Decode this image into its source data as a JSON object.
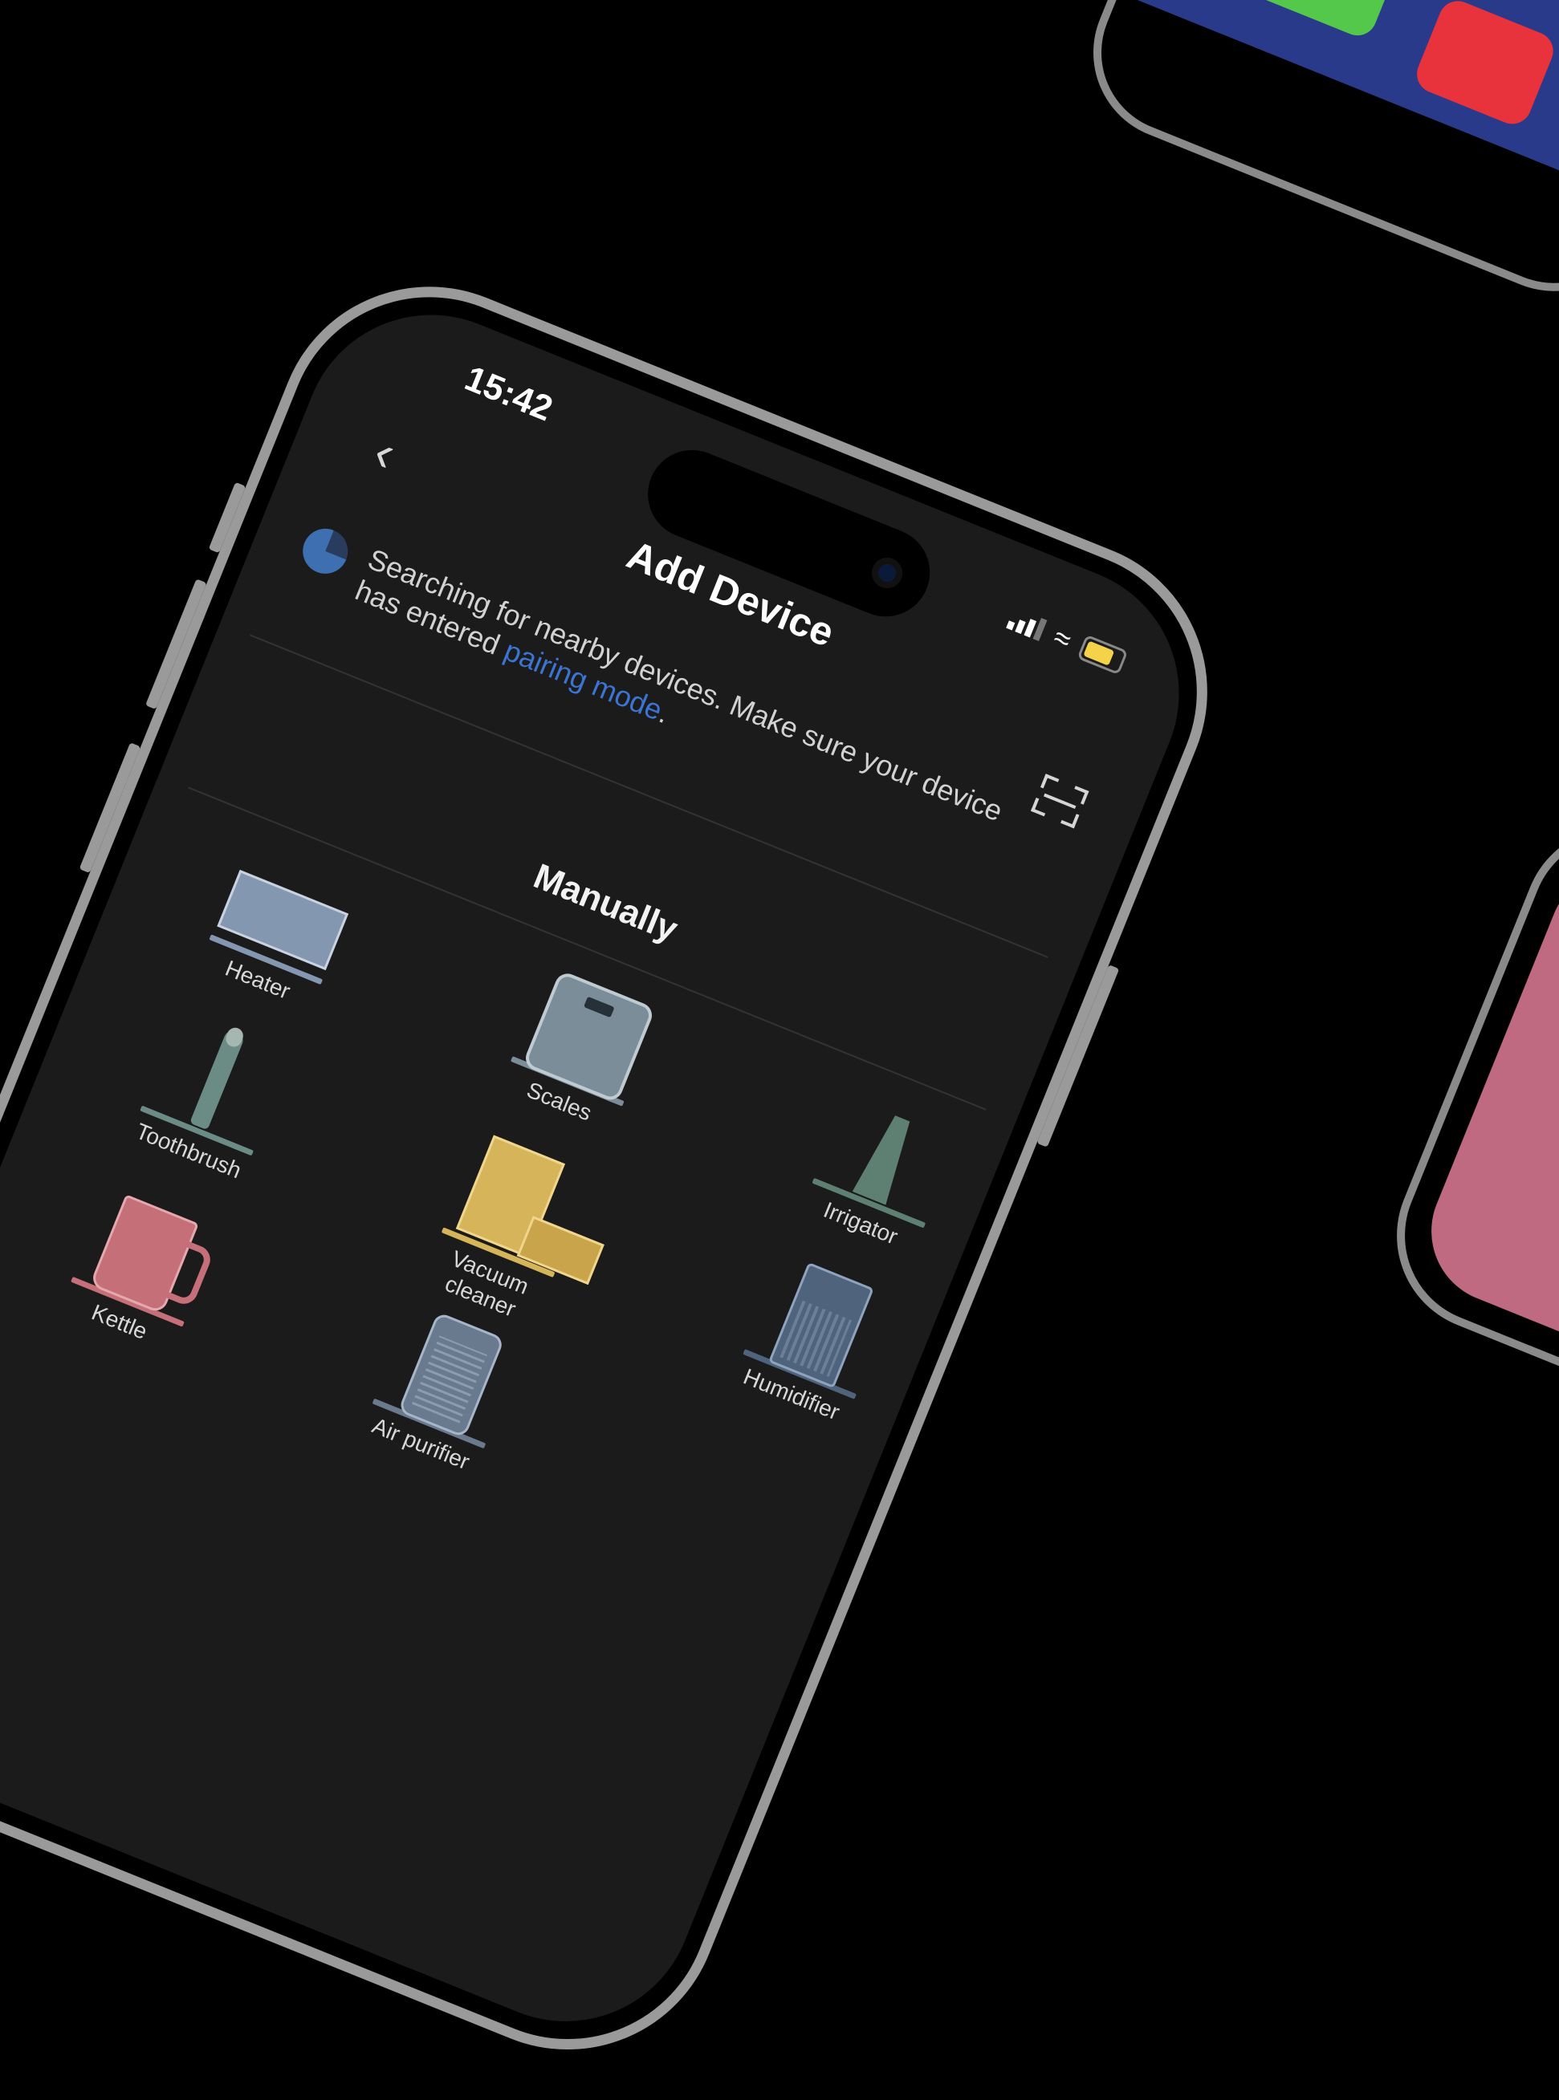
{
  "status_bar": {
    "time": "15:42"
  },
  "header": {
    "title": "Add Device",
    "back_icon": "chevron-left-icon",
    "scan_icon": "scan-icon"
  },
  "search": {
    "text_before": "Searching for nearby devices. Make sure your device has entered ",
    "link_text": "pairing mode",
    "text_after": "."
  },
  "section": {
    "title": "Manually"
  },
  "devices": [
    {
      "label": "Heater",
      "color": "#8497b0"
    },
    {
      "label": "Scales",
      "color": "#7a8d98"
    },
    {
      "label": "Toothbrush",
      "color": "#6b8c84"
    },
    {
      "label": "Irrigator",
      "color": "#5d8072"
    },
    {
      "label": "Kettle",
      "color": "#c57078"
    },
    {
      "label": "Vacuum cleaner",
      "color": "#d6b55a"
    },
    {
      "label": "Humidifier",
      "color": "#50637c"
    },
    {
      "label": "Air purifier",
      "color": "#6a7a8e"
    }
  ],
  "colors": {
    "background": "#000000",
    "screen": "#1b1b1b",
    "link": "#3c74d4",
    "battery": "#f4d24a"
  }
}
